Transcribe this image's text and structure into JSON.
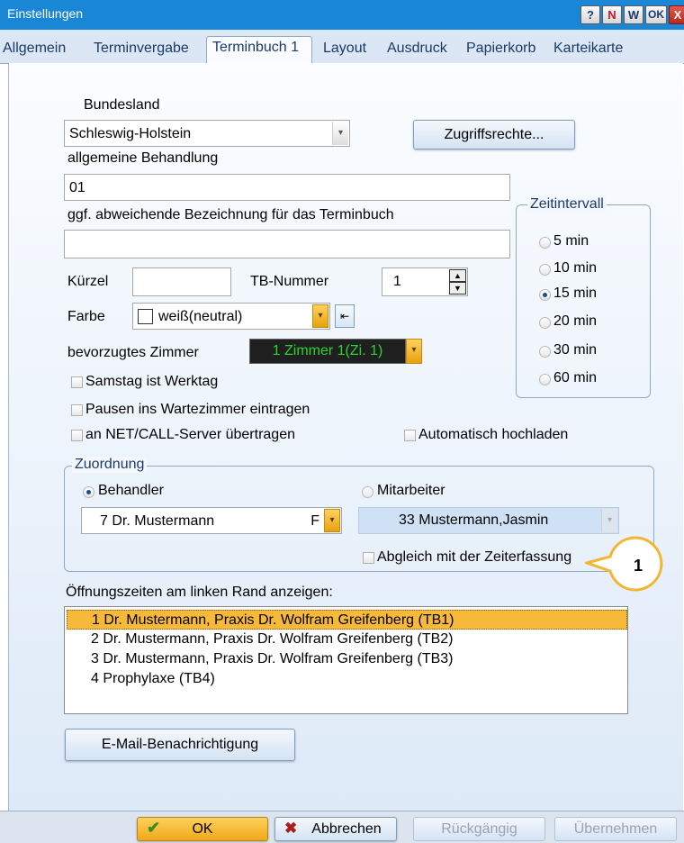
{
  "window": {
    "title": "Einstellungen",
    "title_buttons": [
      "?",
      "N",
      "W",
      "OK",
      "X"
    ]
  },
  "tabs": [
    "Allgemein",
    "Terminvergabe",
    "Terminbuch 1",
    "Layout",
    "Ausdruck",
    "Papierkorb",
    "Karteikarte"
  ],
  "active_tab": "Terminbuch 1",
  "form": {
    "bundesland_label": "Bundesland",
    "bundesland_value": "Schleswig-Holstein",
    "zugriffsrechte_button": "Zugriffsrechte...",
    "behandlung_label": "allgemeine Behandlung",
    "behandlung_value": "01",
    "bezeichnung_label": "ggf. abweichende Bezeichnung für das Terminbuch",
    "bezeichnung_value": "",
    "kuerzel_label": "Kürzel",
    "kuerzel_value": "",
    "tb_nummer_label": "TB-Nummer",
    "tb_nummer_value": "1",
    "farbe_label": "Farbe",
    "farbe_value": "weiß(neutral)",
    "zimmer_label": "bevorzugtes Zimmer",
    "zimmer_value": "1 Zimmer 1(Zi. 1)",
    "zimmer_bg": "#1f1f1f",
    "zimmer_fg": "#2bd42b",
    "samstag_label": "Samstag ist Werktag",
    "pausen_label": "Pausen ins Wartezimmer eintragen",
    "netcall_label": "an NET/CALL-Server übertragen",
    "hochladen_label": "Automatisch hochladen"
  },
  "zeitintervall": {
    "title": "Zeitintervall",
    "options": [
      "5 min",
      "10 min",
      "15 min",
      "20 min",
      "30 min",
      "60 min"
    ],
    "selected": "15 min"
  },
  "zuordnung": {
    "title": "Zuordnung",
    "behandler_label": "Behandler",
    "mitarbeiter_label": "Mitarbeiter",
    "behandler_value": "7 Dr. Mustermann",
    "behandler_suffix": "F",
    "mitarbeiter_value": "33  Mustermann,Jasmin",
    "abgleich_label": "Abgleich mit der Zeiterfassung"
  },
  "callout": {
    "number": "1",
    "color": "#f2b632"
  },
  "oeffnung": {
    "label": "Öffnungszeiten am linken Rand anzeigen:",
    "items": [
      "1 Dr. Mustermann, Praxis Dr. Wolfram Greifenberg (TB1)",
      "2 Dr. Mustermann, Praxis Dr. Wolfram Greifenberg (TB2)",
      "3 Dr. Mustermann, Praxis Dr. Wolfram Greifenberg (TB3)",
      "4 Prophylaxe (TB4)"
    ],
    "selected_index": 0,
    "selected_color": "#f7b93a"
  },
  "email_button": "E-Mail-Benachrichtigung",
  "footer": {
    "ok": "OK",
    "abbrechen": "Abbrechen",
    "rueckgaengig": "Rückgängig",
    "uebernehmen": "Übernehmen"
  },
  "accent": "#1a86d6"
}
